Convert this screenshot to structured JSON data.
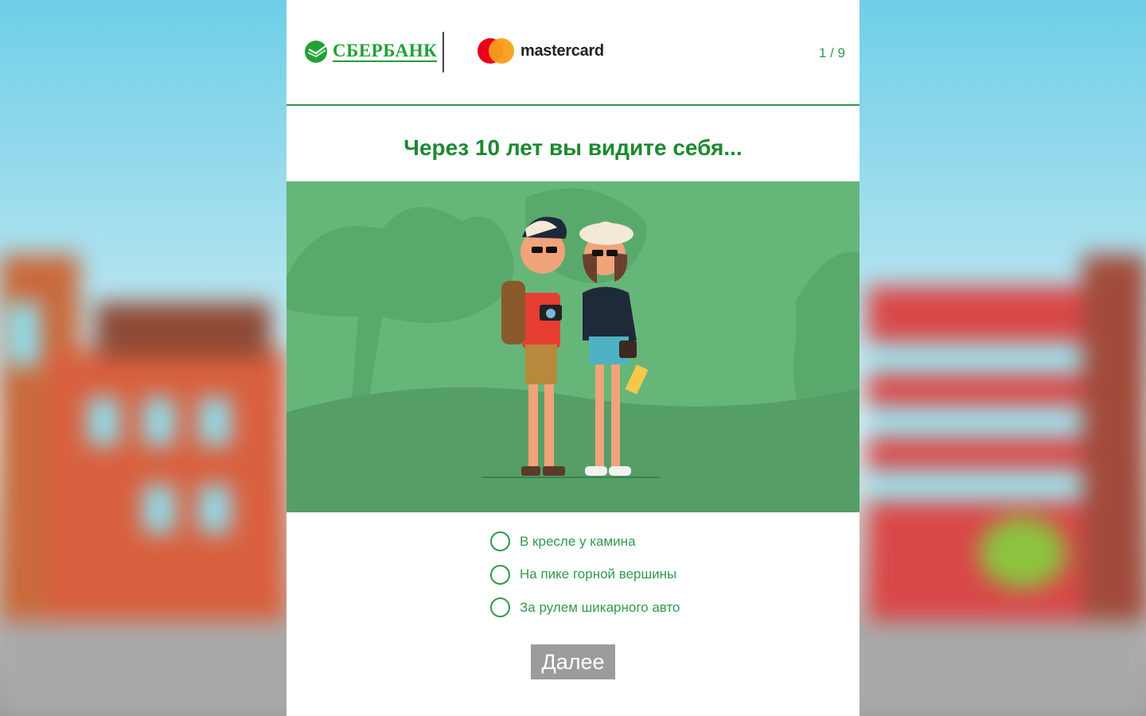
{
  "brand": {
    "sber_name": "СБЕРБАНК",
    "mastercard_name": "mastercard"
  },
  "progress": {
    "counter": "1 / 9"
  },
  "question": {
    "title": "Через 10 лет вы видите себя..."
  },
  "options": [
    {
      "label": "В кресле у камина",
      "selected": false
    },
    {
      "label": "На пике горной вершины",
      "selected": false
    },
    {
      "label": "За рулем шикарного авто",
      "selected": false
    }
  ],
  "actions": {
    "next_label": "Далее"
  },
  "colors": {
    "accent_green": "#2f9a4b",
    "title_green": "#1b8a2f",
    "illustration_bg": "#67b679",
    "button_disabled": "#9c9c9c"
  },
  "icons": {
    "sber_logo": "sberbank-logo-icon",
    "mastercard_logo": "mastercard-logo-icon",
    "radio": "radio-unchecked-icon"
  }
}
